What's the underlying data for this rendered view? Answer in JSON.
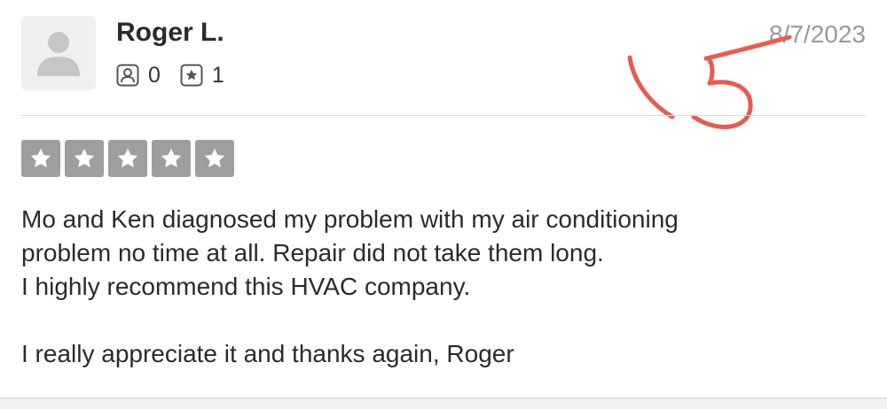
{
  "review": {
    "author": {
      "name": "Roger L.",
      "avatar_icon": "default-user-avatar-icon"
    },
    "stats": {
      "friends_icon": "friends-icon",
      "friends_count": "0",
      "reviews_icon": "reviews-star-icon",
      "reviews_count": "1"
    },
    "date": "8/7/2023",
    "rating": {
      "stars": 5,
      "max": 5,
      "icon": "star-icon",
      "color": "#9e9e9e"
    },
    "text_lines": [
      "Mo and Ken diagnosed my problem with my air conditioning",
      "problem no time at all. Repair did not take them long.",
      "I highly recommend this HVAC company.",
      "",
      "I really appreciate it and thanks again, Roger"
    ]
  },
  "annotation": {
    "type": "handwritten-mark",
    "color": "#ea5a4f"
  }
}
